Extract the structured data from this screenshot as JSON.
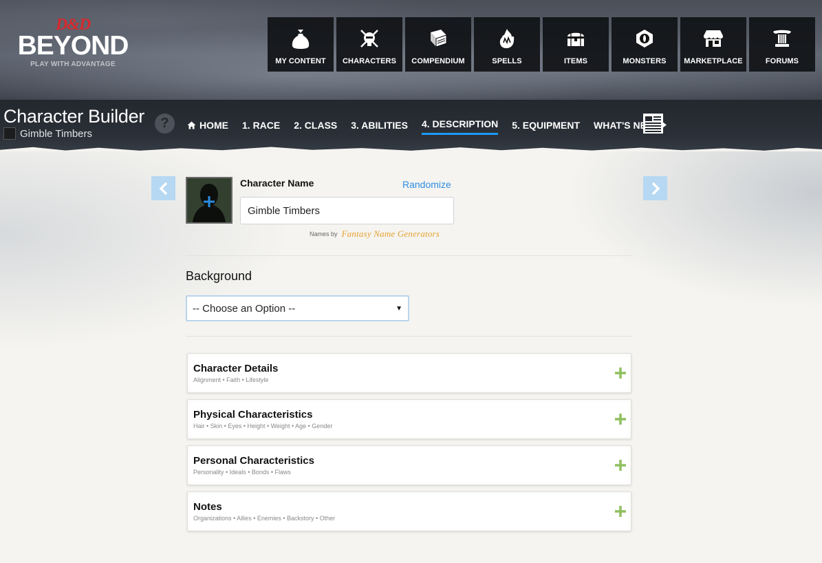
{
  "logo": {
    "brand_top": "D&D",
    "brand_main": "BEYOND",
    "tagline": "PLAY WITH ADVANTAGE"
  },
  "topnav": [
    {
      "label": "MY CONTENT",
      "icon": "bag-icon"
    },
    {
      "label": "CHARACTERS",
      "icon": "helmet-icon"
    },
    {
      "label": "COMPENDIUM",
      "icon": "book-icon"
    },
    {
      "label": "SPELLS",
      "icon": "flame-hand-icon"
    },
    {
      "label": "ITEMS",
      "icon": "chest-icon"
    },
    {
      "label": "MONSTERS",
      "icon": "monster-eye-icon"
    },
    {
      "label": "MARKETPLACE",
      "icon": "shop-icon"
    },
    {
      "label": "FORUMS",
      "icon": "pillar-icon"
    }
  ],
  "builder": {
    "title": "Character Builder",
    "character_name": "Gimble Timbers",
    "help": "?"
  },
  "steps": [
    {
      "label": "HOME",
      "icon": "home-icon",
      "active": false
    },
    {
      "label": "1. RACE",
      "active": false
    },
    {
      "label": "2. CLASS",
      "active": false
    },
    {
      "label": "3. ABILITIES",
      "active": false
    },
    {
      "label": "4. DESCRIPTION",
      "active": true
    },
    {
      "label": "5. EQUIPMENT",
      "active": false
    },
    {
      "label": "WHAT'S NEXT",
      "icon": "caret-right-icon",
      "active": false
    }
  ],
  "form": {
    "name_label": "Character Name",
    "randomize": "Randomize",
    "name_value": "Gimble Timbers",
    "names_by": "Names by",
    "generator": "Fantasy Name Generators",
    "background_label": "Background",
    "background_selected": "-- Choose an Option --"
  },
  "sections": [
    {
      "title": "Character Details",
      "subtitle": "Alignment • Faith • Lifestyle"
    },
    {
      "title": "Physical Characteristics",
      "subtitle": "Hair • Skin • Eyes • Height • Weight • Age • Gender"
    },
    {
      "title": "Personal Characteristics",
      "subtitle": "Personality • Ideals • Bonds • Flaws"
    },
    {
      "title": "Notes",
      "subtitle": "Organizations • Allies • Enemies • Backstory • Other"
    }
  ],
  "colors": {
    "accent_blue": "#1b9af7",
    "link_blue": "#2b8de3",
    "brand_red": "#d6292d",
    "plus_green": "#8fbf5e",
    "arrow_bg": "#b6d8f2"
  }
}
